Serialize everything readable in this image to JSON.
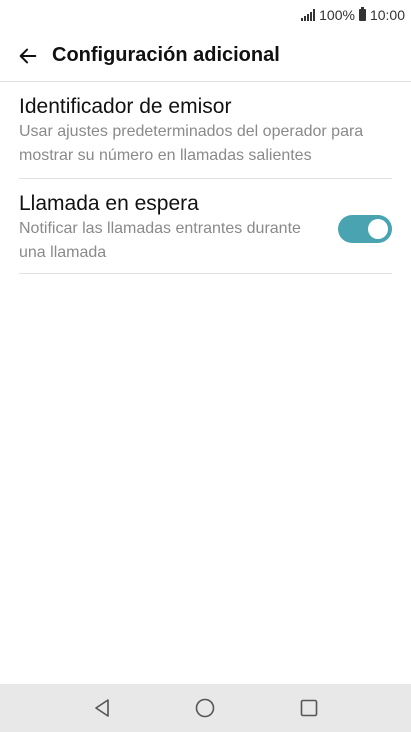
{
  "status_bar": {
    "battery_percent": "100%",
    "time": "10:00"
  },
  "app_bar": {
    "title": "Configuración adicional"
  },
  "settings": [
    {
      "title": "Identificador de emisor",
      "description": "Usar ajustes predeterminados del operador para mostrar su número en llamadas salientes"
    },
    {
      "title": "Llamada en espera",
      "description": "Notificar las llamadas entrantes durante una llamada",
      "toggle_on": true
    }
  ],
  "colors": {
    "toggle_on": "#4aa3b0",
    "nav_bar_bg": "#e8e8e8",
    "secondary_text": "#8a8a8a"
  },
  "nav_bar": {
    "icons": [
      "back-triangle-icon",
      "home-circle-icon",
      "recents-square-icon"
    ]
  }
}
